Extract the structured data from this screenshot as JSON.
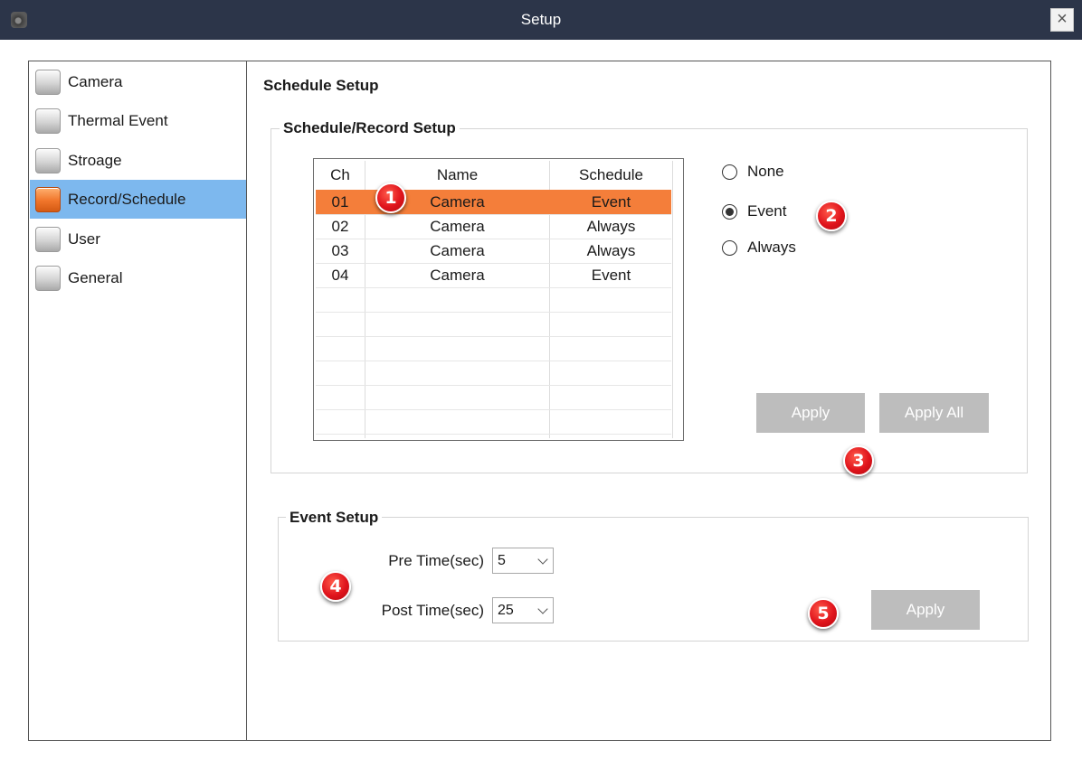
{
  "window": {
    "title": "Setup",
    "close_glyph": "×"
  },
  "sidebar": {
    "items": [
      {
        "label": "Camera",
        "icon": "camera-icon",
        "active": false
      },
      {
        "label": "Thermal Event",
        "icon": "thermal-event-icon",
        "active": false
      },
      {
        "label": "Stroage",
        "icon": "storage-icon",
        "active": false
      },
      {
        "label": "Record/Schedule",
        "icon": "record-schedule-icon",
        "active": true
      },
      {
        "label": "User",
        "icon": "user-icon",
        "active": false
      },
      {
        "label": "General",
        "icon": "general-icon",
        "active": false
      }
    ]
  },
  "main": {
    "title": "Schedule Setup",
    "schedule_group": {
      "title": "Schedule/Record Setup",
      "table": {
        "columns": [
          "Ch",
          "Name",
          "Schedule"
        ],
        "rows": [
          {
            "ch": "01",
            "name": "Camera",
            "schedule": "Event",
            "selected": true
          },
          {
            "ch": "02",
            "name": "Camera",
            "schedule": "Always",
            "selected": false
          },
          {
            "ch": "03",
            "name": "Camera",
            "schedule": "Always",
            "selected": false
          },
          {
            "ch": "04",
            "name": "Camera",
            "schedule": "Event",
            "selected": false
          }
        ]
      },
      "options": [
        {
          "label": "None",
          "checked": false
        },
        {
          "label": "Event",
          "checked": true
        },
        {
          "label": "Always",
          "checked": false
        }
      ],
      "apply_label": "Apply",
      "apply_all_label": "Apply All"
    },
    "event_group": {
      "title": "Event Setup",
      "pre_time_label": "Pre Time(sec)",
      "pre_time_value": "5",
      "post_time_label": "Post Time(sec)",
      "post_time_value": "25",
      "apply_label": "Apply"
    }
  },
  "callouts": [
    "1",
    "2",
    "3",
    "4",
    "5"
  ],
  "colors": {
    "titlebar": "#2c3549",
    "sidebar_active": "#7db8ee",
    "selected_row": "#f47e3a",
    "button_disabled": "#bdbdbd",
    "callout": "#e0141c"
  }
}
